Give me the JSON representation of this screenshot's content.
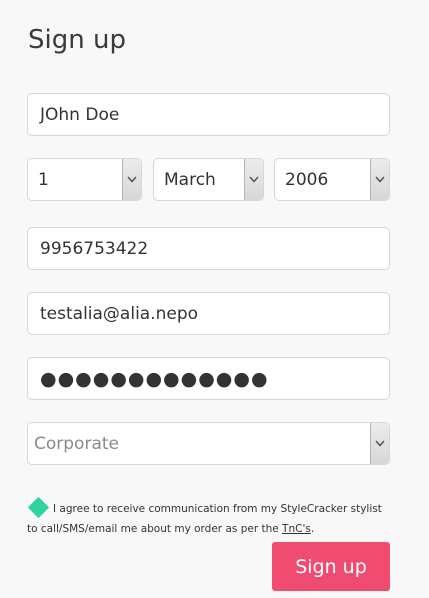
{
  "page": {
    "title": "Sign up"
  },
  "form": {
    "name_value": "JOhn Doe",
    "dob_day": "1",
    "dob_month": "March",
    "dob_year": "2006",
    "phone_value": "9956753422",
    "email_value": "testalia@alia.nepo",
    "password_mask": "●●●●●●●●●●●●●",
    "account_type_placeholder": "Corporate",
    "consent_text": "I agree to receive communication from my StyleCracker stylist to call/SMS/email me about my order as per the ",
    "consent_link": "TnC's",
    "consent_end": ".",
    "submit_label": "Sign up"
  },
  "icons": {
    "select_arrow": "chevron-down-icon",
    "consent_checkbox": "diamond-check-icon"
  },
  "colors": {
    "background": "#f8f8f8",
    "primary_button": "#f04b70",
    "checkbox_accent": "#2fd49b",
    "border": "#d6d6d6"
  }
}
